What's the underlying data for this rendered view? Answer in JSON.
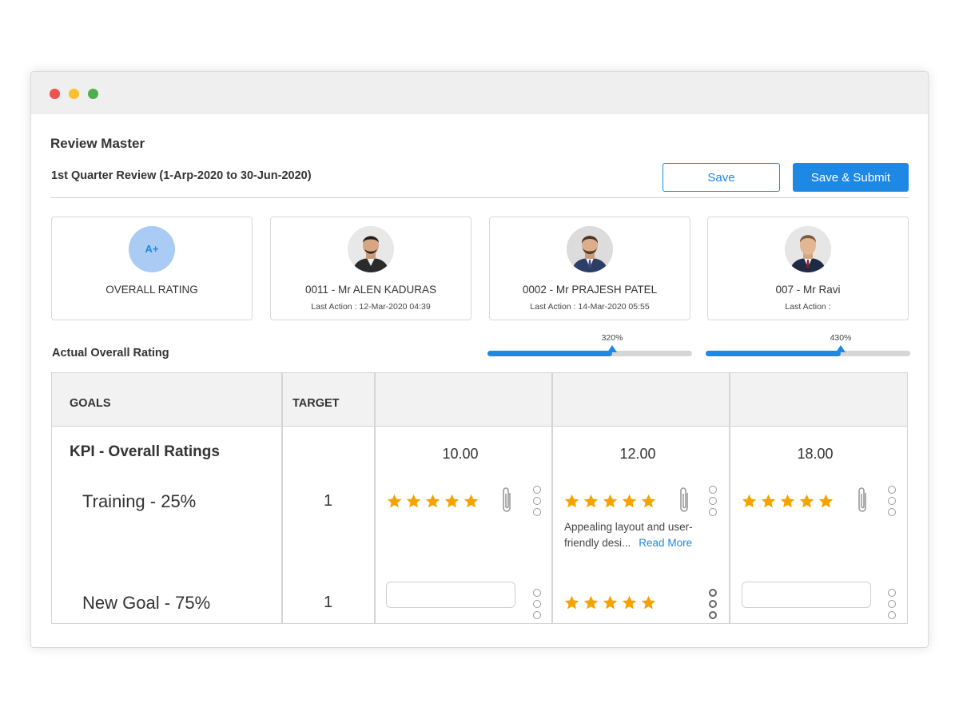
{
  "window": {
    "controls": [
      "close-dot",
      "minimize-dot",
      "maximize-dot"
    ],
    "colors": {
      "close": "#ef5350",
      "minimize": "#fbc02d",
      "maximize": "#4caf50"
    }
  },
  "page": {
    "title": "Review Master",
    "period": "1st Quarter Review (1-Arp-2020 to 30-Jun-2020)"
  },
  "actions": {
    "save_label": "Save",
    "submit_label": "Save & Submit",
    "accent": "#1e88e5"
  },
  "overall_card": {
    "badge": "A+",
    "label": "OVERALL RATING"
  },
  "reviewers": [
    {
      "name": "0011 - Mr ALEN KADURAS",
      "last_action": "Last Action : 12-Mar-2020 04:39",
      "avatar_icon": "person-avatar"
    },
    {
      "name": "0002 - Mr PRAJESH PATEL",
      "last_action": "Last Action : 14-Mar-2020 05:55",
      "avatar_icon": "person-avatar"
    },
    {
      "name": "007 - Mr Ravi",
      "last_action": "Last Action :",
      "avatar_icon": "person-avatar"
    }
  ],
  "actual_rating": {
    "label": "Actual Overall Rating",
    "progress": [
      {
        "label": "320%",
        "fraction": 0.61
      },
      {
        "label": "430%",
        "fraction": 0.66
      }
    ]
  },
  "table": {
    "headers": {
      "goals": "GOALS",
      "target": "TARGET"
    },
    "kpi_title": "KPI - Overall Ratings",
    "scores": [
      "10.00",
      "12.00",
      "18.00"
    ],
    "rows": [
      {
        "goal": "Training - 25%",
        "target": "1",
        "ratings": [
          5,
          5,
          5
        ]
      },
      {
        "goal": "New Goal - 75%",
        "target": "1",
        "ratings": [
          null,
          5,
          null
        ]
      }
    ],
    "comment": {
      "text": "Appealing layout and user-friendly desi...",
      "read_more": "Read More"
    },
    "star_color": "#f5a300"
  }
}
